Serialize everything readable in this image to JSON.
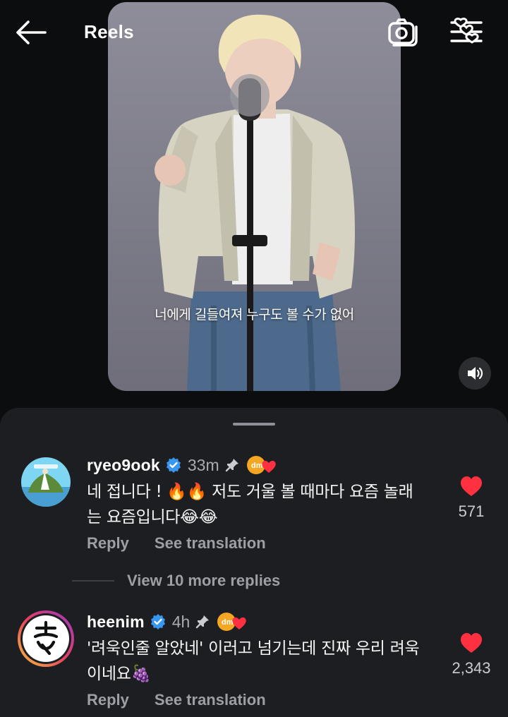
{
  "header": {
    "title": "Reels",
    "back_icon": "arrow-left-icon",
    "camera_icon": "camera-icon",
    "filter_icon": "filter-sliders-icon"
  },
  "reel": {
    "caption": "너에게 길들여져 누구도 볼 수가 없어",
    "volume_icon": "speaker-icon"
  },
  "comments": [
    {
      "username": "ryeo9ook",
      "time": "33m",
      "text": "네 접니다 ! 🔥🔥 저도 거울 볼 때마다 요즘 놀래는 요즘입니다😂😂",
      "reply_label": "Reply",
      "translate_label": "See translation",
      "likes": "571",
      "verified": true,
      "pinned": true
    },
    {
      "username": "heenim",
      "time": "4h",
      "text": "'려욱인줄 알았네' 이러고 넘기는데 진짜 우리 려욱이네요🍇",
      "reply_label": "Reply",
      "translate_label": "See translation",
      "likes": "2,343",
      "verified": true,
      "pinned": true
    }
  ],
  "view_more_replies": "View 10 more replies",
  "colors": {
    "background": "#0b0d0f",
    "sheet": "#1c1e21",
    "verified_blue": "#3897f0",
    "like_red": "#ff3040",
    "muted_text": "#9c9fa5"
  }
}
